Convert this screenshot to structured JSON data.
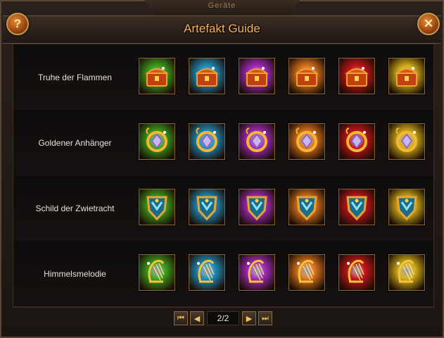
{
  "window": {
    "top_label": "Geräte",
    "title": "Artefakt Guide",
    "help_glyph": "?",
    "close_glyph": "✕"
  },
  "tiers": [
    {
      "name": "green",
      "color": "#3fa31e"
    },
    {
      "name": "blue",
      "color": "#1f8fbf"
    },
    {
      "name": "purple",
      "color": "#a52bbf"
    },
    {
      "name": "orange",
      "color": "#e0761c"
    },
    {
      "name": "red",
      "color": "#c8151a"
    },
    {
      "name": "gold",
      "color": "#d7b21a"
    }
  ],
  "rows": [
    {
      "label": "Truhe der Flammen",
      "icon": "treasure-chest-icon"
    },
    {
      "label": "Goldener Anhänger",
      "icon": "amulet-icon"
    },
    {
      "label": "Schild der Zwietracht",
      "icon": "shield-icon"
    },
    {
      "label": "Himmelsmelodie",
      "icon": "harp-icon"
    }
  ],
  "pagination": {
    "page_text": "2/2",
    "first_glyph": "⏮",
    "prev_glyph": "◀",
    "next_glyph": "▶",
    "last_glyph": "⏭"
  }
}
